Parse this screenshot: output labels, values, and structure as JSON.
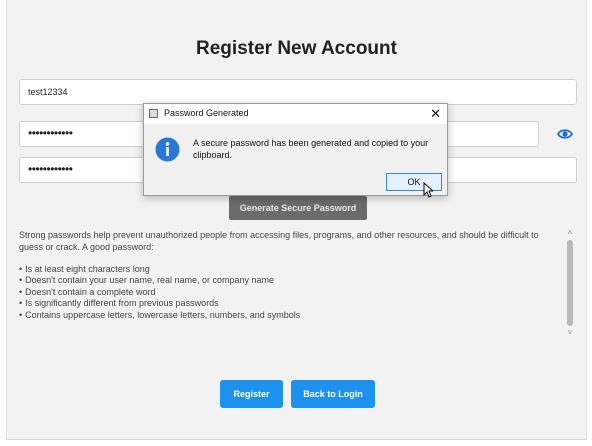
{
  "page": {
    "title": "Register New Account"
  },
  "form": {
    "username_value": "test12334",
    "password_value": "••••••••••••",
    "confirm_password_value": "••••••••••••",
    "show_password_icon": "eye-icon",
    "generate_button_label": "Generate Secure Password"
  },
  "info": {
    "intro": "Strong passwords help prevent unauthorized people from accessing files, programs, and other resources, and should be difficult to guess or crack. A good password:",
    "bullets": [
      "Is at least eight characters long",
      "Doesn't contain your user name, real name, or company name",
      "Doesn't contain a complete word",
      "Is significantly different from previous passwords",
      "Contains uppercase letters, lowercase letters, numbers, and symbols"
    ]
  },
  "actions": {
    "register_label": "Register",
    "back_label": "Back to Login"
  },
  "dialog": {
    "title": "Password Generated",
    "close_glyph": "✕",
    "message": "A secure password has been generated and copied to your clipboard.",
    "ok_label": "OK",
    "icon": "info-icon"
  },
  "colors": {
    "accent": "#1e90ee",
    "disabled_button": "#6b6b6b",
    "background": "#f2f2f2"
  }
}
